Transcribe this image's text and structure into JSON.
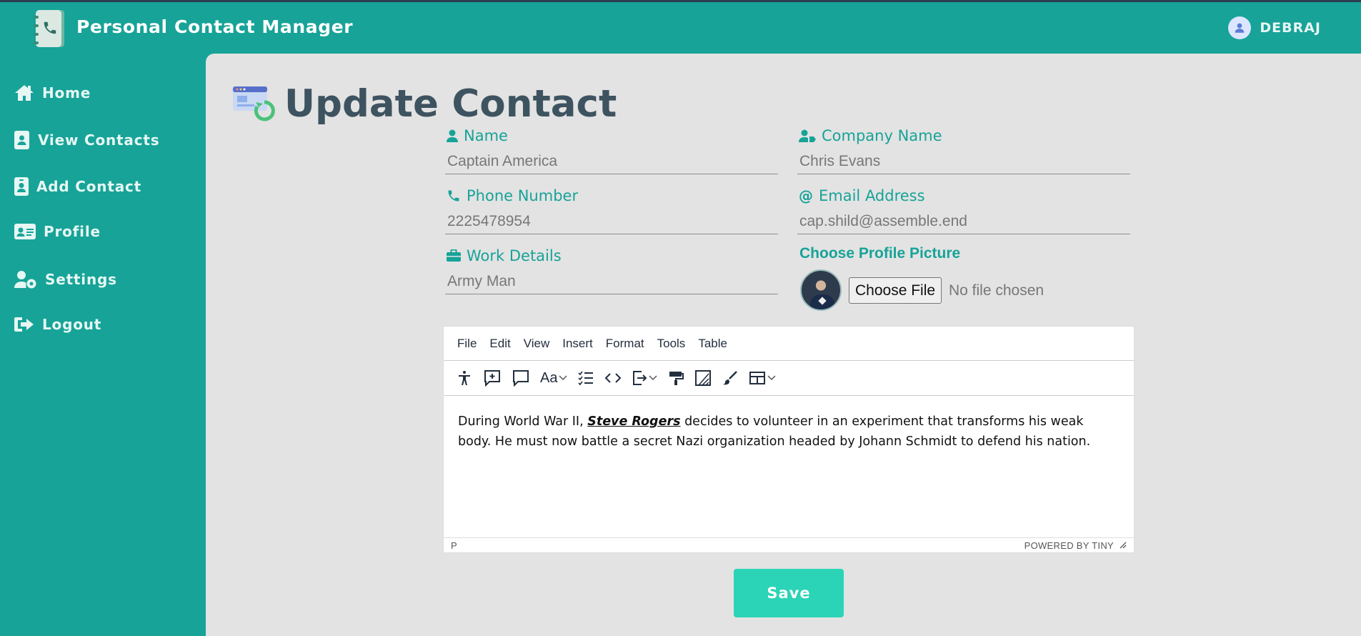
{
  "header": {
    "app_title": "Personal Contact Manager",
    "username": "DEBRAJ"
  },
  "sidebar": {
    "items": [
      {
        "label": "Home",
        "icon": "home-icon"
      },
      {
        "label": "View Contacts",
        "icon": "address-book-icon"
      },
      {
        "label": "Add Contact",
        "icon": "contact-card-icon"
      },
      {
        "label": "Profile",
        "icon": "id-card-icon"
      },
      {
        "label": "Settings",
        "icon": "user-cog-icon"
      },
      {
        "label": "Logout",
        "icon": "logout-icon"
      }
    ]
  },
  "main": {
    "title": "Update Contact",
    "fields": {
      "name": {
        "label": "Name",
        "value": "Captain America"
      },
      "company": {
        "label": "Company Name",
        "value": "Chris Evans"
      },
      "phone": {
        "label": "Phone Number",
        "value": "2225478954"
      },
      "email": {
        "label": "Email Address",
        "value": "cap.shild@assemble.end"
      },
      "work": {
        "label": "Work Details",
        "value": "Army Man"
      }
    },
    "profile_picture": {
      "label": "Choose Profile Picture",
      "button": "Choose File",
      "status": "No file chosen"
    },
    "editor": {
      "menu": [
        "File",
        "Edit",
        "View",
        "Insert",
        "Format",
        "Tools",
        "Table"
      ],
      "content_before": "During World War II, ",
      "content_emphasis": "Steve Rogers",
      "content_after": " decides to volunteer in an experiment that transforms his weak body. He must now battle a secret Nazi organization headed by Johann Schmidt to defend his nation.",
      "status_path": "P",
      "powered_by": "POWERED BY TINY"
    },
    "save_label": "Save"
  },
  "colors": {
    "primary": "#17a398",
    "save": "#2bd4b7",
    "title": "#3e5360",
    "panel": "#e3e3e3"
  }
}
